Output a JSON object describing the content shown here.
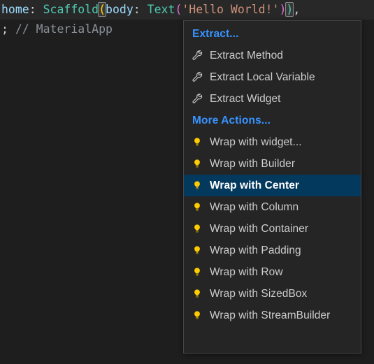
{
  "editor": {
    "lines": [
      {
        "id": "line-1",
        "segments": [
          {
            "text": "home",
            "kind": "var"
          },
          {
            "text": ": ",
            "kind": "plain"
          },
          {
            "text": "Scaffold",
            "kind": "type"
          },
          {
            "text": "(",
            "kind": "bracket-yellow-boxed"
          },
          {
            "text": "body",
            "kind": "var"
          },
          {
            "text": ": ",
            "kind": "plain"
          },
          {
            "text": "Text",
            "kind": "type"
          },
          {
            "text": "(",
            "kind": "bracket-pink"
          },
          {
            "text": "'Hello World!'",
            "kind": "string"
          },
          {
            "text": ")",
            "kind": "bracket-pink"
          },
          {
            "text": ")",
            "kind": "bracket-yellow-boxed"
          },
          {
            "text": ",",
            "kind": "plain"
          }
        ],
        "plain_text": "home: Scaffold(body: Text('Hello World!')),"
      },
      {
        "id": "line-2",
        "segments": [
          {
            "text": ";",
            "kind": "plain"
          },
          {
            "text": " // MaterialApp",
            "kind": "comment"
          }
        ],
        "plain_text": "; // MaterialApp"
      }
    ]
  },
  "context_menu": {
    "name": "quick-fix-lightbulb-menu",
    "selected_index": 2,
    "sections": [
      {
        "header": "Extract...",
        "header_icon": "none",
        "items": [
          {
            "label": "Extract Method",
            "icon": "wrench-icon",
            "selected": false
          },
          {
            "label": "Extract Local Variable",
            "icon": "wrench-icon",
            "selected": false
          },
          {
            "label": "Extract Widget",
            "icon": "wrench-icon",
            "selected": false
          }
        ]
      },
      {
        "header": "More Actions...",
        "header_icon": "none",
        "items": [
          {
            "label": "Wrap with widget...",
            "icon": "lightbulb-icon",
            "selected": false
          },
          {
            "label": "Wrap with Builder",
            "icon": "lightbulb-icon",
            "selected": false
          },
          {
            "label": "Wrap with Center",
            "icon": "lightbulb-icon",
            "selected": true
          },
          {
            "label": "Wrap with Column",
            "icon": "lightbulb-icon",
            "selected": false
          },
          {
            "label": "Wrap with Container",
            "icon": "lightbulb-icon",
            "selected": false
          },
          {
            "label": "Wrap with Padding",
            "icon": "lightbulb-icon",
            "selected": false
          },
          {
            "label": "Wrap with Row",
            "icon": "lightbulb-icon",
            "selected": false
          },
          {
            "label": "Wrap with SizedBox",
            "icon": "lightbulb-icon",
            "selected": false
          },
          {
            "label": "Wrap with StreamBuilder",
            "icon": "lightbulb-icon",
            "selected": false
          }
        ]
      }
    ]
  },
  "colors": {
    "editor_background": "#1e1e1e",
    "current_line_background": "#282828",
    "menu_background": "#252526",
    "menu_border": "#454545",
    "selection_background": "#04395e",
    "section_header_text": "#3794ff",
    "item_text": "#cccccc",
    "lightbulb_yellow": "#ffcc00",
    "wrench_grey": "#c5c5c5",
    "identifier_blue": "#9cdcfe",
    "type_teal": "#4ec9b0",
    "string_orange": "#ce9178",
    "comment_grey": "#8a9199",
    "bracket_yellow": "#ffd700",
    "bracket_pink": "#da70d6"
  }
}
